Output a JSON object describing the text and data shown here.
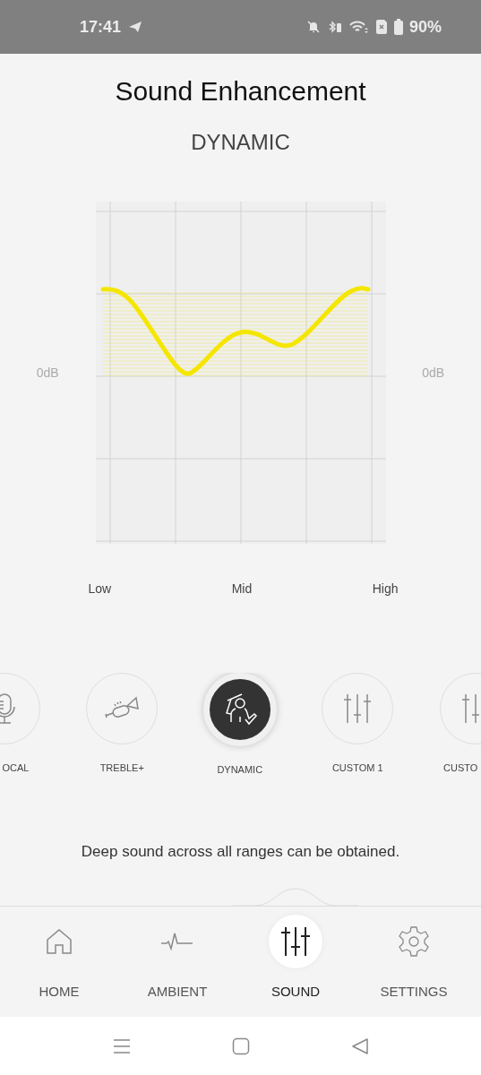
{
  "status_bar": {
    "time": "17:41",
    "battery": "90%"
  },
  "title": "Sound Enhancement",
  "preset_name": "DYNAMIC",
  "eq": {
    "left_label": "0dB",
    "right_label": "0dB",
    "bands": [
      "Low",
      "Mid",
      "High"
    ]
  },
  "presets": [
    {
      "label": "OCAL",
      "selected": false
    },
    {
      "label": "TREBLE+",
      "selected": false
    },
    {
      "label": "DYNAMIC",
      "selected": true
    },
    {
      "label": "CUSTOM 1",
      "selected": false
    },
    {
      "label": "CUSTO",
      "selected": false
    }
  ],
  "description": "Deep sound across all ranges can be obtained.",
  "tabs": [
    {
      "label": "HOME",
      "selected": false
    },
    {
      "label": "AMBIENT",
      "selected": false
    },
    {
      "label": "SOUND",
      "selected": true
    },
    {
      "label": "SETTINGS",
      "selected": false
    }
  ]
}
